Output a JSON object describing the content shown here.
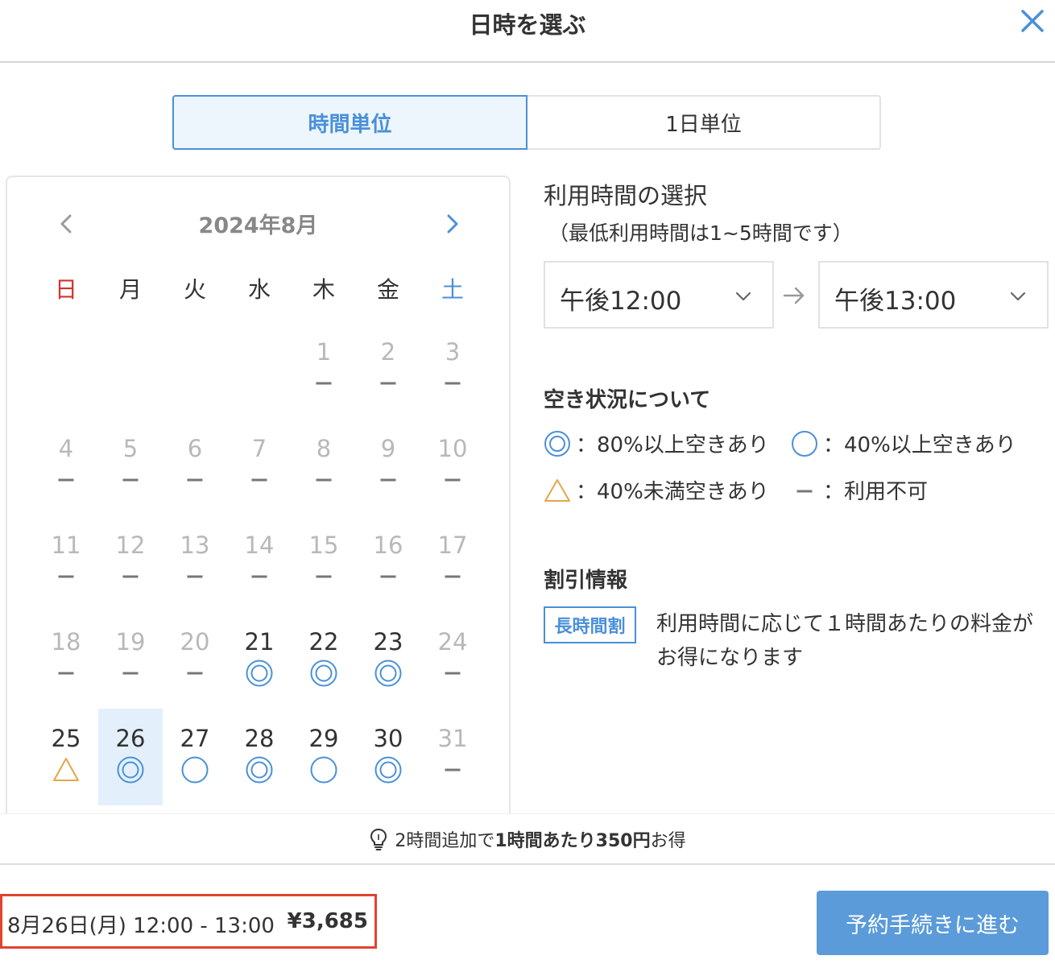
{
  "header": {
    "title": "日時を選ぶ"
  },
  "mode_tabs": [
    {
      "label": "時間単位",
      "active": true
    },
    {
      "label": "1日単位",
      "active": false
    }
  ],
  "calendar": {
    "month_label": "2024年8月",
    "weekdays": [
      "日",
      "月",
      "火",
      "水",
      "木",
      "金",
      "土"
    ],
    "leading_blanks": 4,
    "selected_day": 26,
    "days": [
      {
        "d": "1",
        "s": "none"
      },
      {
        "d": "2",
        "s": "none"
      },
      {
        "d": "3",
        "s": "none"
      },
      {
        "d": "4",
        "s": "none"
      },
      {
        "d": "5",
        "s": "none"
      },
      {
        "d": "6",
        "s": "none"
      },
      {
        "d": "7",
        "s": "none"
      },
      {
        "d": "8",
        "s": "none"
      },
      {
        "d": "9",
        "s": "none"
      },
      {
        "d": "10",
        "s": "none"
      },
      {
        "d": "11",
        "s": "none"
      },
      {
        "d": "12",
        "s": "none"
      },
      {
        "d": "13",
        "s": "none"
      },
      {
        "d": "14",
        "s": "none"
      },
      {
        "d": "15",
        "s": "none"
      },
      {
        "d": "16",
        "s": "none"
      },
      {
        "d": "17",
        "s": "none"
      },
      {
        "d": "18",
        "s": "none"
      },
      {
        "d": "19",
        "s": "none"
      },
      {
        "d": "20",
        "s": "none"
      },
      {
        "d": "21",
        "s": "double"
      },
      {
        "d": "22",
        "s": "double"
      },
      {
        "d": "23",
        "s": "double"
      },
      {
        "d": "24",
        "s": "none"
      },
      {
        "d": "25",
        "s": "triangle"
      },
      {
        "d": "26",
        "s": "double"
      },
      {
        "d": "27",
        "s": "circle"
      },
      {
        "d": "28",
        "s": "double"
      },
      {
        "d": "29",
        "s": "circle"
      },
      {
        "d": "30",
        "s": "double"
      },
      {
        "d": "31",
        "s": "none"
      }
    ]
  },
  "time": {
    "title": "利用時間の選択",
    "subtitle": "（最低利用時間は1~5時間です）",
    "start": "午後12:00",
    "end": "午後13:00"
  },
  "availability": {
    "title": "空き状況について",
    "legend": [
      {
        "icon": "double-circle-icon",
        "text": "：80%以上空きあり"
      },
      {
        "icon": "circle-icon",
        "text": "：40%以上空きあり"
      },
      {
        "icon": "triangle-icon",
        "text": "：40%未満空きあり"
      },
      {
        "icon": "dash-icon",
        "text": "：利用不可"
      }
    ]
  },
  "discount": {
    "title": "割引情報",
    "badge": "長時間割",
    "text": "利用時間に応じて１時間あたりの料金がお得になります"
  },
  "tip": {
    "prefix": "2時間追加で",
    "bold": "1時間あたり350円",
    "suffix": "お得"
  },
  "summary": {
    "date_time": "8月26日(月) 12:00 - 13:00",
    "price": "¥3,685"
  },
  "cta": {
    "label": "予約手続きに進む"
  },
  "colors": {
    "accent": "#4a90d9",
    "sunday": "#d0332a",
    "triangle": "#e0a84a",
    "cta_bg": "#5b9bd9",
    "summary_border": "#e0432f"
  }
}
